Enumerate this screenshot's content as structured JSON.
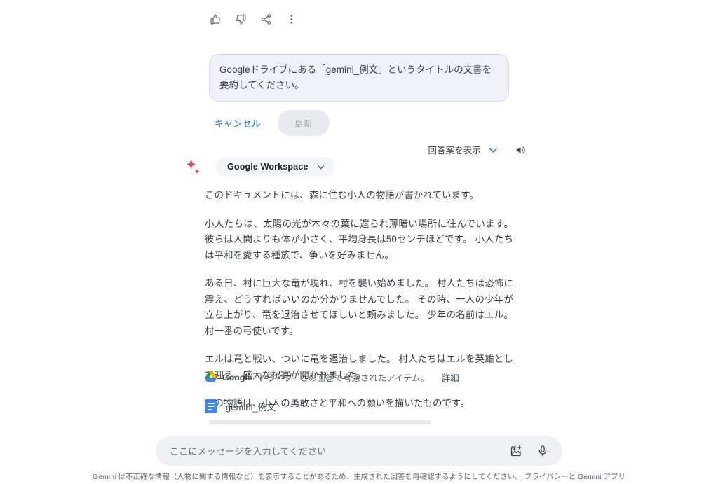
{
  "action_icons": [
    {
      "name": "thumb-up-icon",
      "label": "高評価"
    },
    {
      "name": "thumb-down-icon",
      "label": "低評価"
    },
    {
      "name": "share-icon",
      "label": "共有"
    },
    {
      "name": "more-options-icon",
      "label": "その他のオプション"
    }
  ],
  "edit_prompt": {
    "value": "Googleドライブにある「gemini_例文」というタイトルの文書を要約してください。",
    "cancel_label": "キャンセル",
    "update_label": "更新",
    "update_disabled": true
  },
  "drafts": {
    "label": "回答案を表示",
    "chevron_icon": "chevron-down-icon",
    "speaker_icon": "speaker-icon"
  },
  "model": {
    "sparkle_icon": "gemini-sparkle-icon",
    "extension_chip": "Google Workspace",
    "chip_chevron_icon": "chevron-down-icon"
  },
  "answer": {
    "paragraphs": [
      "このドキュメントには、森に住む小人の物語が書かれています。",
      "小人たちは、太陽の光が木々の葉に遮られ薄暗い場所に住んでいます。 彼らは人間よりも体が小さく、平均身長は50センチほどです。 小人たちは平和を愛する種族で、争いを好みません。",
      "ある日、村に巨大な竜が現れ、村を襲い始めました。 村人たちは恐怖に震え、どうすればいいのか分かりませんでした。 その時、一人の少年が立ち上がり、竜を退治させてほしいと頼みました。 少年の名前はエル。村一番の弓使いです。",
      "エルは竜と戦い、ついに竜を退治しました。 村人たちはエルを英雄として迎え、盛大な祝宴が開かれました。",
      "この物語は、小人の勇敢さと平和への願いを描いたものです。"
    ]
  },
  "sources": {
    "drive_icon": "google-drive-icon",
    "drive_name": "Google",
    "drive_name_suffix": "ドライブ",
    "note": "この回答で考慮されたアイテム。",
    "more_link": "詳細",
    "items": [
      {
        "icon": "google-docs-icon",
        "name": "gemini_例文"
      }
    ]
  },
  "composer": {
    "placeholder": "ここにメッセージを入力してください",
    "value": "",
    "image_icon": "add-image-icon",
    "mic_icon": "microphone-icon"
  },
  "footer": {
    "disclaimer": "Gemini は不正確な情報（人物に関する情報など）を表示することがあるため、生成された回答を再確認するようにしてください。",
    "privacy_link": "プライバシーと Gemini アプリ"
  },
  "colors": {
    "accent_blue": "#1a73e8",
    "surface": "#eff1f7",
    "text": "#3c4043"
  }
}
